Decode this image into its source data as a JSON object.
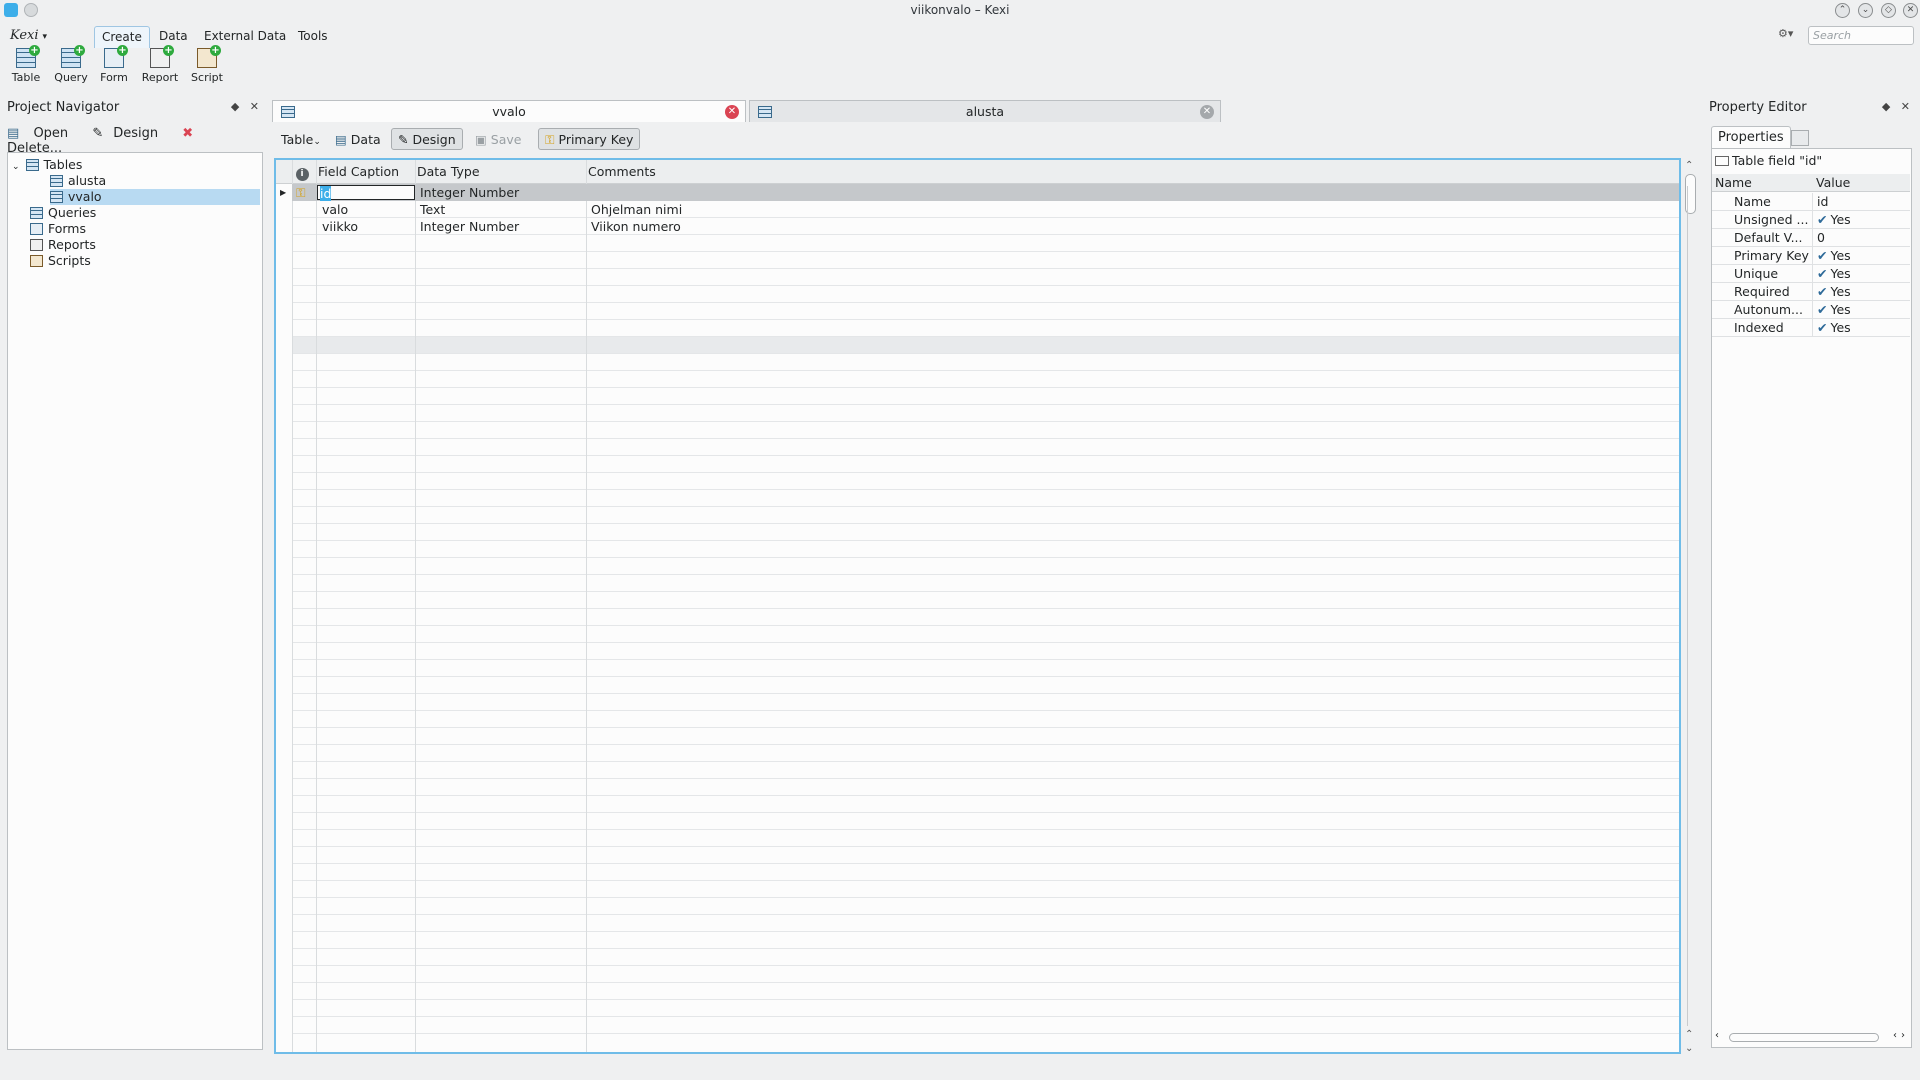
{
  "window": {
    "title": "viikonvalo – Kexi",
    "search_placeholder": "Search"
  },
  "menu": {
    "app_logo": "Kexi",
    "tabs": [
      "Create",
      "Data",
      "External Data",
      "Tools"
    ],
    "active_tab": "Create"
  },
  "toolbar": {
    "buttons": [
      {
        "label": "Table",
        "icon": "table-add-icon"
      },
      {
        "label": "Query",
        "icon": "query-add-icon"
      },
      {
        "label": "Form",
        "icon": "form-add-icon"
      },
      {
        "label": "Report",
        "icon": "report-add-icon"
      },
      {
        "label": "Script",
        "icon": "script-add-icon"
      }
    ]
  },
  "project_navigator": {
    "title": "Project Navigator",
    "actions": {
      "open": "Open",
      "design": "Design",
      "delete": "Delete..."
    },
    "tree": {
      "tables": "Tables",
      "table_items": [
        "alusta",
        "vvalo"
      ],
      "selected": "vvalo",
      "queries": "Queries",
      "forms": "Forms",
      "reports": "Reports",
      "scripts": "Scripts"
    }
  },
  "documents": {
    "tabs": [
      {
        "label": "vvalo",
        "active": true
      },
      {
        "label": "alusta",
        "active": false
      }
    ]
  },
  "design_toolbar": {
    "table_menu": "Table",
    "data": "Data",
    "design": "Design",
    "save": "Save",
    "primary_key": "Primary Key"
  },
  "table_design": {
    "headers": {
      "info": "i",
      "field_caption": "Field Caption",
      "data_type": "Data Type",
      "comments": "Comments"
    },
    "rows": [
      {
        "caption": "id",
        "type": "Integer Number",
        "comment": "",
        "primary_key": true
      },
      {
        "caption": "valo",
        "type": "Text",
        "comment": "Ohjelman nimi",
        "primary_key": false
      },
      {
        "caption": "viikko",
        "type": "Integer Number",
        "comment": "Viikon numero",
        "primary_key": false
      }
    ]
  },
  "property_editor": {
    "title": "Property Editor",
    "tab_properties": "Properties",
    "object_label": "Table field \"id\"",
    "col_name": "Name",
    "col_value": "Value",
    "properties": [
      {
        "name": "Name",
        "value": "id",
        "checked": false
      },
      {
        "name": "Unsigned ...",
        "value": "Yes",
        "checked": true
      },
      {
        "name": "Default V...",
        "value": "0",
        "checked": false
      },
      {
        "name": "Primary Key",
        "value": "Yes",
        "checked": true
      },
      {
        "name": "Unique",
        "value": "Yes",
        "checked": true
      },
      {
        "name": "Required",
        "value": "Yes",
        "checked": true
      },
      {
        "name": "Autonum...",
        "value": "Yes",
        "checked": true
      },
      {
        "name": "Indexed",
        "value": "Yes",
        "checked": true
      }
    ]
  },
  "colors": {
    "accent": "#3daee9",
    "selection": "#b8daf2",
    "close_red": "#da4453"
  }
}
